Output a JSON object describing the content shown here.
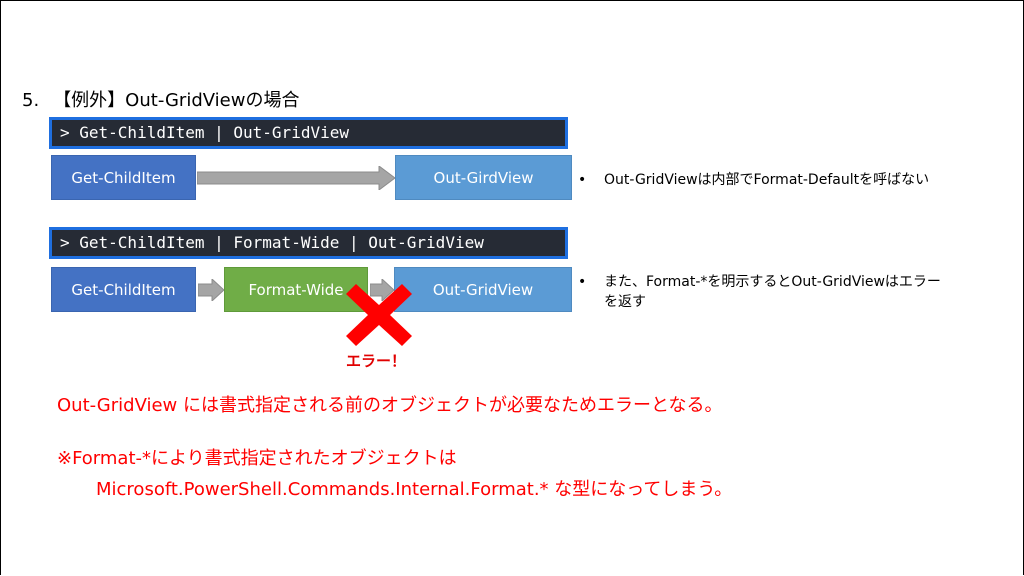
{
  "heading": {
    "number": "5.",
    "text": "【例外】Out-GridViewの場合"
  },
  "example1": {
    "command": "> Get-ChildItem | Out-GridView",
    "box_left": "Get-ChildItem",
    "box_right": "Out-GirdView",
    "bullet": "•",
    "note": "Out-GridViewは内部でFormat-Defaultを呼ばない"
  },
  "example2": {
    "command": "> Get-ChildItem | Format-Wide | Out-GridView",
    "box_left": "Get-ChildItem",
    "box_middle": "Format-Wide",
    "box_right": "Out-GridView",
    "bullet": "•",
    "note_line1": "また、Format-*を明示するとOut-GridViewはエラー",
    "note_line2": "を返す",
    "error_label": "エラー！"
  },
  "explanation": {
    "line1": "Out-GridView には書式指定される前のオブジェクトが必要なためエラーとなる。",
    "line2": "※Format-*により書式指定されたオブジェクトは",
    "line3": "Microsoft.PowerShell.Commands.Internal.Format.* な型になってしまう。"
  },
  "colors": {
    "command_bg": "#262b35",
    "command_border": "#1f6fe0",
    "box_dark_blue": "#4472c4",
    "box_light_blue": "#5b9bd5",
    "box_green": "#70ad47",
    "arrow_gray": "#a5a5a5",
    "error_red": "#ff0000"
  },
  "icons": {
    "cross": "red-x-cross-icon",
    "arrow": "right-arrow-icon"
  }
}
